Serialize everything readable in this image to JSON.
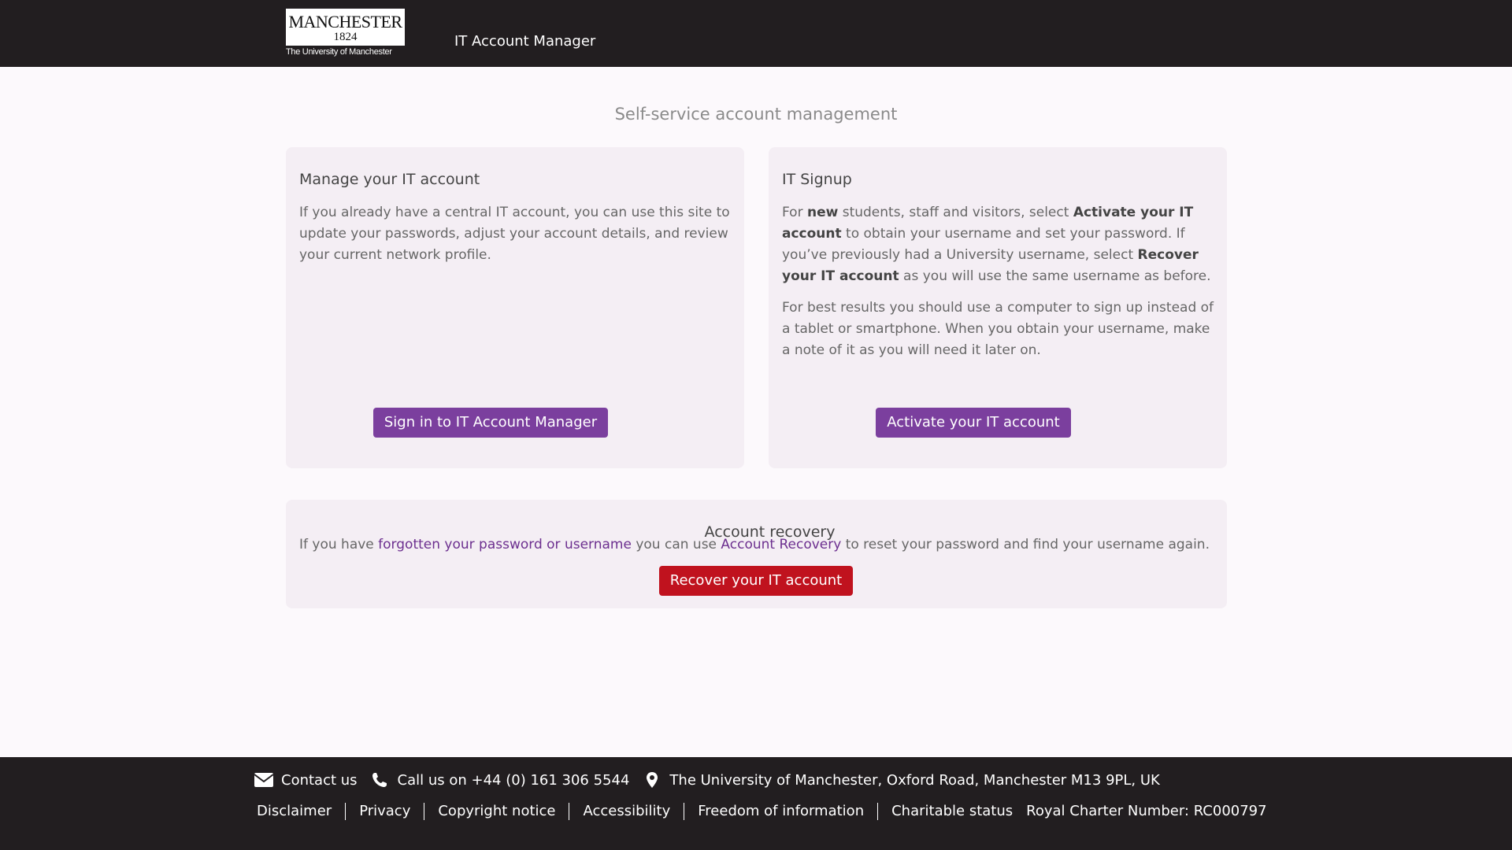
{
  "header": {
    "logo": {
      "wordmark": "MANCHESTER",
      "year": "1824",
      "subtitle": "The University of Manchester"
    },
    "app_title": "IT Account Manager"
  },
  "main": {
    "heading": "Self-service account management",
    "manage_card": {
      "title": "Manage your IT account",
      "text": "If you already have a central IT account, you can use this site to update your passwords, adjust your account details, and review your current network profile.",
      "button_label": "Sign in to IT Account Manager"
    },
    "signup_card": {
      "title": "IT Signup",
      "p1": {
        "t1": "For ",
        "b1": "new",
        "t2": " students, staff and visitors, select ",
        "b2": "Activate your IT account",
        "t3": " to obtain your username and set your password. If you’ve previously had a University username, select ",
        "b3": "Recover your IT account",
        "t4": " as you will use the same username as before."
      },
      "p2": "For best results you should use a computer to sign up instead of a tablet or smartphone. When you obtain your username, make a note of it as you will need it later on.",
      "button_label": "Activate your IT account"
    },
    "recovery_card": {
      "title": "Account recovery",
      "t1": "If you have ",
      "link1": "forgotten your password or username",
      "t2": " you can use ",
      "link2": "Account Recovery",
      "t3": " to reset your password and find your username again.",
      "button_label": "Recover your IT account"
    }
  },
  "footer": {
    "contact": {
      "email_label": "Contact us",
      "phone_label": "Call us on +44 (0) 161 306 5544",
      "address": "The University of Manchester, Oxford Road, Manchester M13 9PL, UK"
    },
    "links": [
      "Disclaimer",
      "Privacy",
      "Copyright notice",
      "Accessibility",
      "Freedom of information",
      "Charitable status"
    ],
    "charter": "Royal Charter Number: RC000797"
  },
  "colors": {
    "header_bg": "#221e20",
    "accent_purple": "#7b3f9e",
    "danger_red": "#c0121e",
    "card_bg": "#f4eef4"
  },
  "icons": [
    "envelope-icon",
    "phone-icon",
    "map-pin-icon"
  ]
}
